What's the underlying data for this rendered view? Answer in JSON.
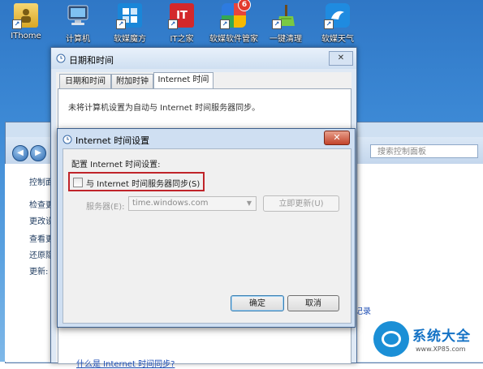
{
  "desktop": {
    "icons": [
      {
        "label": "IThome"
      },
      {
        "label": "计算机"
      },
      {
        "label": "软媒魔方"
      },
      {
        "label": "IT之家",
        "glyph": "IT"
      },
      {
        "label": "软媒软件管家",
        "badge": "6"
      },
      {
        "label": "一键清理"
      },
      {
        "label": "软媒天气"
      }
    ]
  },
  "control_panel": {
    "search_placeholder": "搜索控制面板",
    "side_items": [
      "控制面",
      "检查更",
      "更改设",
      "查看更",
      "还原隐",
      "更新:"
    ],
    "right_link": "记录"
  },
  "datetime_window": {
    "title": "日期和时间",
    "tabs": [
      "日期和时间",
      "附加时钟",
      "Internet 时间"
    ],
    "active_tab": "Internet 时间",
    "message": "未将计算机设置为自动与 Internet 时间服务器同步。",
    "link": "什么是 Internet 时间同步?",
    "close_glyph": "✕"
  },
  "internet_time_dialog": {
    "title": "Internet 时间设置",
    "close_glyph": "✕",
    "config_label": "配置 Internet 时间设置:",
    "sync_checkbox_label": "与 Internet 时间服务器同步(S)",
    "sync_checked": false,
    "server_label": "服务器(E):",
    "server_value": "time.windows.com",
    "update_now_button": "立即更新(U)",
    "ok_button": "确定",
    "cancel_button": "取消"
  },
  "watermark": {
    "text": "系统大全",
    "url": "www.XP85.com"
  },
  "colors": {
    "highlight_box": "#c0242a",
    "link": "#1f4fb5",
    "close_button": "#c2432b"
  }
}
